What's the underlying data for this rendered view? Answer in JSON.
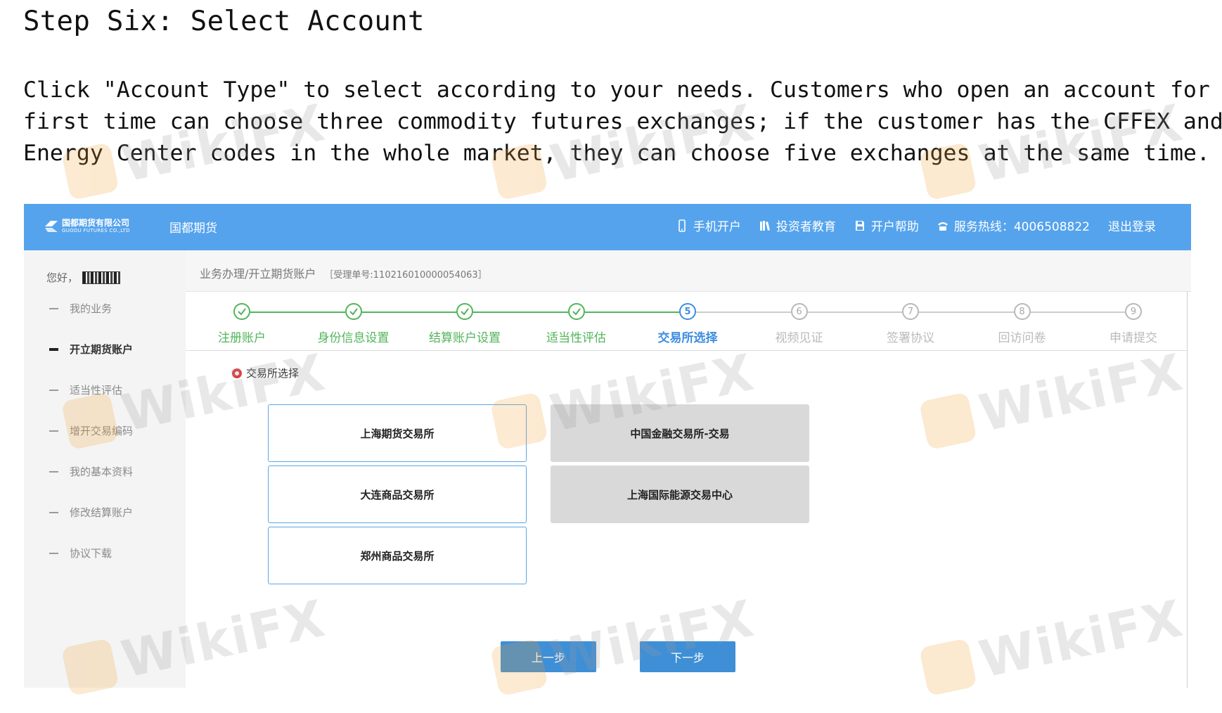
{
  "document": {
    "title": "Step Six: Select Account",
    "paragraph_lines": [
      "Click \"Account Type\" to select according to your needs. Customers who open an account for the",
      "first time can choose three commodity futures exchanges; if the customer has the CFFEX and",
      "Energy Center codes in the whole market, they can choose five exchanges at the same time."
    ]
  },
  "app": {
    "logo_cn": "国都期货有限公司",
    "logo_en": "GUODU FUTURES CO.,LTD",
    "brand": "国都期货",
    "nav": [
      {
        "label": "手机开户",
        "icon": "phone-icon"
      },
      {
        "label": "投资者教育",
        "icon": "books-icon"
      },
      {
        "label": "开户帮助",
        "icon": "save-icon"
      },
      {
        "label": "服务热线：4006508822",
        "icon": "telephone-icon"
      },
      {
        "label": "退出登录",
        "icon": ""
      }
    ],
    "accent_color": "#55a3ed"
  },
  "sidebar": {
    "greeting": "您好，",
    "items": [
      {
        "label": "我的业务",
        "active": false
      },
      {
        "label": "开立期货账户",
        "active": true
      },
      {
        "label": "适当性评估",
        "active": false
      },
      {
        "label": "增开交易编码",
        "active": false
      },
      {
        "label": "我的基本资料",
        "active": false
      },
      {
        "label": "修改结算账户",
        "active": false
      },
      {
        "label": "协议下载",
        "active": false
      }
    ]
  },
  "breadcrumb": {
    "path": "业务办理/开立期货账户",
    "order_no": "［受理单号:110216010000054063］"
  },
  "steps": [
    {
      "label": "注册账户",
      "number": "",
      "state": "done"
    },
    {
      "label": "身份信息设置",
      "number": "",
      "state": "done"
    },
    {
      "label": "结算账户设置",
      "number": "",
      "state": "done"
    },
    {
      "label": "适当性评估",
      "number": "",
      "state": "done"
    },
    {
      "label": "交易所选择",
      "number": "5",
      "state": "current"
    },
    {
      "label": "视频见证",
      "number": "6",
      "state": "pending"
    },
    {
      "label": "签署协议",
      "number": "7",
      "state": "pending"
    },
    {
      "label": "回访问卷",
      "number": "8",
      "state": "pending"
    },
    {
      "label": "申请提交",
      "number": "9",
      "state": "pending"
    }
  ],
  "section": {
    "heading": "交易所选择"
  },
  "exchanges": {
    "left": [
      {
        "label": "上海期货交易所",
        "selected": false
      },
      {
        "label": "大连商品交易所",
        "selected": false
      },
      {
        "label": "郑州商品交易所",
        "selected": false
      }
    ],
    "right": [
      {
        "label": "中国金融交易所-交易",
        "selected": true
      },
      {
        "label": "上海国际能源交易中心",
        "selected": true
      }
    ]
  },
  "buttons": {
    "prev": "上一步",
    "next": "下一步"
  },
  "watermark": "WikiFX"
}
